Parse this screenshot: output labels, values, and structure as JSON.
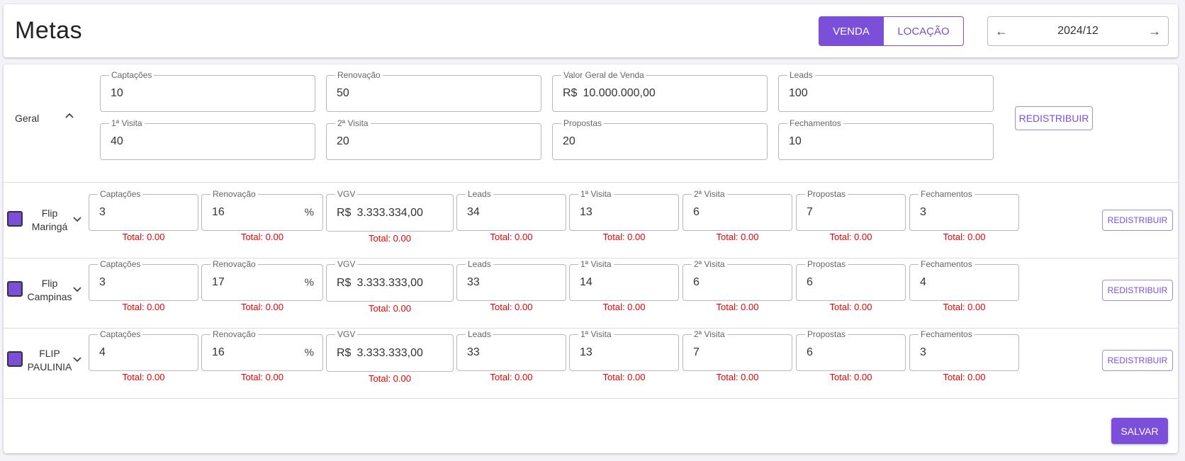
{
  "header": {
    "title": "Metas",
    "toggle": {
      "active": "VENDA",
      "inactive": "LOCAÇÃO"
    },
    "period": {
      "value": "2024/12",
      "prev_icon": "arrow-left-icon",
      "next_icon": "arrow-right-icon"
    }
  },
  "geral": {
    "label": "Geral",
    "fields": [
      {
        "label": "Captações",
        "value": "10"
      },
      {
        "label": "Renovação",
        "value": "50"
      },
      {
        "label": "Valor Geral de Venda",
        "prefix": "R$",
        "value": "10.000.000,00"
      },
      {
        "label": "Leads",
        "value": "100"
      },
      {
        "label": "1ª Visita",
        "value": "40"
      },
      {
        "label": "2ª Visita",
        "value": "20"
      },
      {
        "label": "Propostas",
        "value": "20"
      },
      {
        "label": "Fechamentos",
        "value": "10"
      }
    ],
    "redistribute_label": "REDISTRIBUIR"
  },
  "branches": [
    {
      "name_line1": "Flip",
      "name_line2": "Maringá",
      "fields": [
        {
          "label": "Captações",
          "value": "3",
          "total": "Total: 0.00"
        },
        {
          "label": "Renovação",
          "value": "16",
          "suffix": "%",
          "total": "Total: 0.00"
        },
        {
          "label": "VGV",
          "prefix": "R$",
          "value": "3.333.334,00",
          "total": "Total: 0.00"
        },
        {
          "label": "Leads",
          "value": "34",
          "total": "Total: 0.00"
        },
        {
          "label": "1ª Visita",
          "value": "13",
          "total": "Total: 0.00"
        },
        {
          "label": "2ª Visita",
          "value": "6",
          "total": "Total: 0.00"
        },
        {
          "label": "Propostas",
          "value": "7",
          "total": "Total: 0.00"
        },
        {
          "label": "Fechamentos",
          "value": "3",
          "total": "Total: 0.00"
        }
      ],
      "redistribute_label": "REDISTRIBUIR"
    },
    {
      "name_line1": "Flip",
      "name_line2": "Campinas",
      "fields": [
        {
          "label": "Captações",
          "value": "3",
          "total": "Total: 0.00"
        },
        {
          "label": "Renovação",
          "value": "17",
          "suffix": "%",
          "total": "Total: 0.00"
        },
        {
          "label": "VGV",
          "prefix": "R$",
          "value": "3.333.333,00",
          "total": "Total: 0.00"
        },
        {
          "label": "Leads",
          "value": "33",
          "total": "Total: 0.00"
        },
        {
          "label": "1ª Visita",
          "value": "14",
          "total": "Total: 0.00"
        },
        {
          "label": "2ª Visita",
          "value": "6",
          "total": "Total: 0.00"
        },
        {
          "label": "Propostas",
          "value": "6",
          "total": "Total: 0.00"
        },
        {
          "label": "Fechamentos",
          "value": "4",
          "total": "Total: 0.00"
        }
      ],
      "redistribute_label": "REDISTRIBUIR"
    },
    {
      "name_line1": "FLIP",
      "name_line2": "PAULINIA",
      "fields": [
        {
          "label": "Captações",
          "value": "4",
          "total": "Total: 0.00"
        },
        {
          "label": "Renovação",
          "value": "16",
          "suffix": "%",
          "total": "Total: 0.00"
        },
        {
          "label": "VGV",
          "prefix": "R$",
          "value": "3.333.333,00",
          "total": "Total: 0.00"
        },
        {
          "label": "Leads",
          "value": "33",
          "total": "Total: 0.00"
        },
        {
          "label": "1ª Visita",
          "value": "13",
          "total": "Total: 0.00"
        },
        {
          "label": "2ª Visita",
          "value": "7",
          "total": "Total: 0.00"
        },
        {
          "label": "Propostas",
          "value": "6",
          "total": "Total: 0.00"
        },
        {
          "label": "Fechamentos",
          "value": "3",
          "total": "Total: 0.00"
        }
      ],
      "redistribute_label": "REDISTRIBUIR"
    }
  ],
  "footer": {
    "save_label": "SALVAR"
  },
  "colors": {
    "accent": "#7b4fd9",
    "error": "#ee0000"
  }
}
